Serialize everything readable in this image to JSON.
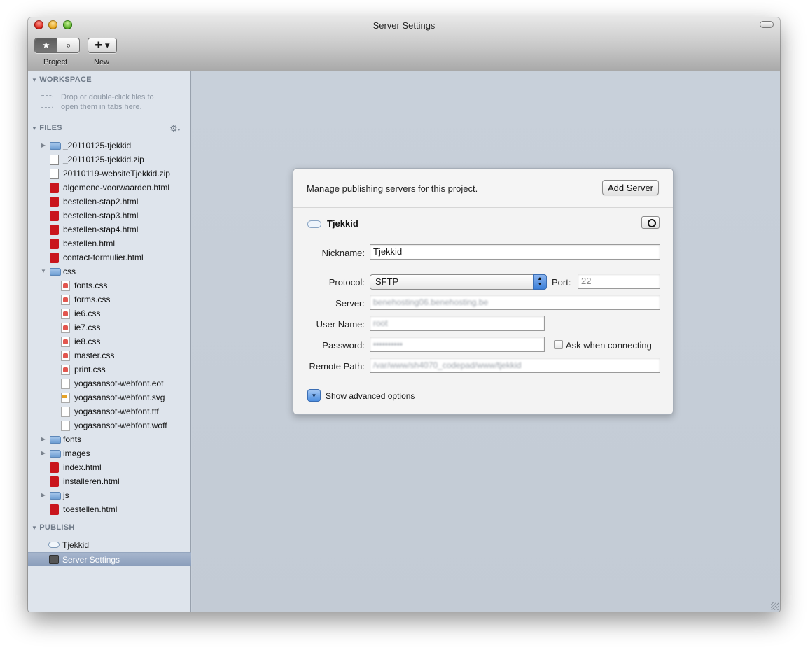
{
  "window": {
    "title": "Server Settings"
  },
  "toolbar": {
    "project_label": "Project",
    "new_label": "New",
    "star_glyph": "★",
    "search_glyph": "⌕",
    "add_glyph": "✚ ▾"
  },
  "sidebar": {
    "workspace": {
      "heading": "WORKSPACE",
      "hint_line1": "Drop or double-click files to",
      "hint_line2": "open them in tabs here."
    },
    "files": {
      "heading": "FILES",
      "items": [
        {
          "name": "_20110125-tjekkid",
          "type": "folder",
          "depth": 0,
          "disclosure": "▶"
        },
        {
          "name": "_20110125-tjekkid.zip",
          "type": "zip",
          "depth": 0,
          "disclosure": ""
        },
        {
          "name": "20110119-websiteTjekkid.zip",
          "type": "zip",
          "depth": 0,
          "disclosure": ""
        },
        {
          "name": "algemene-voorwaarden.html",
          "type": "html",
          "depth": 0,
          "disclosure": ""
        },
        {
          "name": "bestellen-stap2.html",
          "type": "html",
          "depth": 0,
          "disclosure": ""
        },
        {
          "name": "bestellen-stap3.html",
          "type": "html",
          "depth": 0,
          "disclosure": ""
        },
        {
          "name": "bestellen-stap4.html",
          "type": "html",
          "depth": 0,
          "disclosure": ""
        },
        {
          "name": "bestellen.html",
          "type": "html",
          "depth": 0,
          "disclosure": ""
        },
        {
          "name": "contact-formulier.html",
          "type": "html",
          "depth": 0,
          "disclosure": ""
        },
        {
          "name": "css",
          "type": "folder",
          "depth": 0,
          "disclosure": "▼"
        },
        {
          "name": "fonts.css",
          "type": "css",
          "depth": 1,
          "disclosure": ""
        },
        {
          "name": "forms.css",
          "type": "css",
          "depth": 1,
          "disclosure": ""
        },
        {
          "name": "ie6.css",
          "type": "css",
          "depth": 1,
          "disclosure": ""
        },
        {
          "name": "ie7.css",
          "type": "css",
          "depth": 1,
          "disclosure": ""
        },
        {
          "name": "ie8.css",
          "type": "css",
          "depth": 1,
          "disclosure": ""
        },
        {
          "name": "master.css",
          "type": "css",
          "depth": 1,
          "disclosure": ""
        },
        {
          "name": "print.css",
          "type": "css",
          "depth": 1,
          "disclosure": ""
        },
        {
          "name": "yogasansot-webfont.eot",
          "type": "doc",
          "depth": 1,
          "disclosure": ""
        },
        {
          "name": "yogasansot-webfont.svg",
          "type": "svg",
          "depth": 1,
          "disclosure": ""
        },
        {
          "name": "yogasansot-webfont.ttf",
          "type": "doc",
          "depth": 1,
          "disclosure": ""
        },
        {
          "name": "yogasansot-webfont.woff",
          "type": "doc",
          "depth": 1,
          "disclosure": ""
        },
        {
          "name": "fonts",
          "type": "folder",
          "depth": 0,
          "disclosure": "▶"
        },
        {
          "name": "images",
          "type": "folder",
          "depth": 0,
          "disclosure": "▶"
        },
        {
          "name": "index.html",
          "type": "html",
          "depth": 0,
          "disclosure": ""
        },
        {
          "name": "installeren.html",
          "type": "html",
          "depth": 0,
          "disclosure": ""
        },
        {
          "name": "js",
          "type": "folder",
          "depth": 0,
          "disclosure": "▶"
        },
        {
          "name": "toestellen.html",
          "type": "html",
          "depth": 0,
          "disclosure": ""
        }
      ]
    },
    "publish": {
      "heading": "PUBLISH",
      "items": [
        {
          "name": "Tjekkid",
          "icon": "cloud-icon"
        },
        {
          "name": "Server Settings",
          "icon": "server-settings-icon"
        }
      ]
    }
  },
  "panel": {
    "message": "Manage publishing servers for this project.",
    "add_server_label": "Add Server",
    "server_title": "Tjekkid",
    "form": {
      "nickname_label": "Nickname:",
      "nickname_value": "Tjekkid",
      "protocol_label": "Protocol:",
      "protocol_value": "SFTP",
      "port_label": "Port:",
      "port_value": "22",
      "server_label": "Server:",
      "server_value": "benehosting06.benehosting.be",
      "username_label": "User Name:",
      "username_value": "root",
      "password_label": "Password:",
      "password_value": "••••••••••",
      "ask_label": "Ask when connecting",
      "remote_path_label": "Remote Path:",
      "remote_path_value": "/var/www/sh4070_codepad/www/tjekkid"
    },
    "advanced_label": "Show advanced options"
  },
  "colors": {
    "sidebar_bg": "#dee4ec",
    "main_bg": "#c5cdd7",
    "selection": "#8a9dbb",
    "html_icon": "#c9151d",
    "accent_blue": "#3b7fd8"
  }
}
